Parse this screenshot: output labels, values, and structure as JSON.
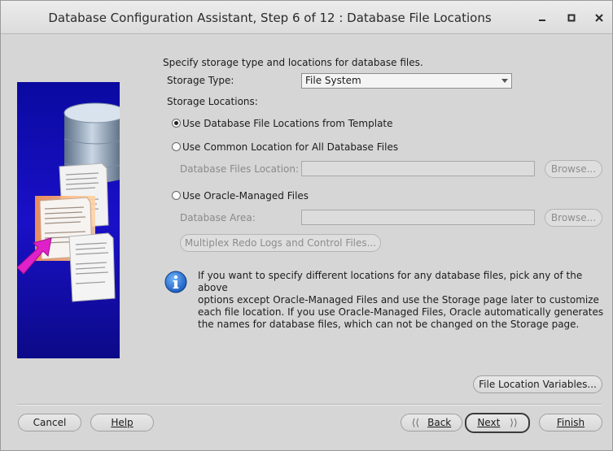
{
  "window": {
    "title": "Database Configuration Assistant, Step 6 of 12 : Database File Locations"
  },
  "header": {
    "instruction": "Specify storage type and locations for database files."
  },
  "storage_type": {
    "label": "Storage Type:",
    "value": "File System"
  },
  "storage_locations": {
    "label": "Storage Locations:",
    "options": [
      {
        "label": "Use Database File Locations from Template",
        "checked": true
      },
      {
        "label": "Use Common Location for All Database Files",
        "checked": false
      },
      {
        "label": "Use Oracle-Managed Files",
        "checked": false
      }
    ]
  },
  "common_location": {
    "field_label": "Database Files Location:",
    "value": "",
    "browse_label": "Browse..."
  },
  "oracle_managed": {
    "field_label": "Database Area:",
    "value": "",
    "browse_label": "Browse...",
    "multiplex_label": "Multiplex Redo Logs and Control Files..."
  },
  "info": {
    "line1": "If you want to specify different locations for any database files, pick any of the above",
    "line2": "options except Oracle-Managed Files and use the Storage page later to customize",
    "line3": "each file location. If you use Oracle-Managed Files, Oracle automatically generates",
    "line4": "the names for database files, which can not be changed on the Storage page."
  },
  "file_location_variables_label": "File Location Variables...",
  "footer": {
    "cancel": "Cancel",
    "help": "Help",
    "back": "Back",
    "next": "Next",
    "finish": "Finish"
  }
}
